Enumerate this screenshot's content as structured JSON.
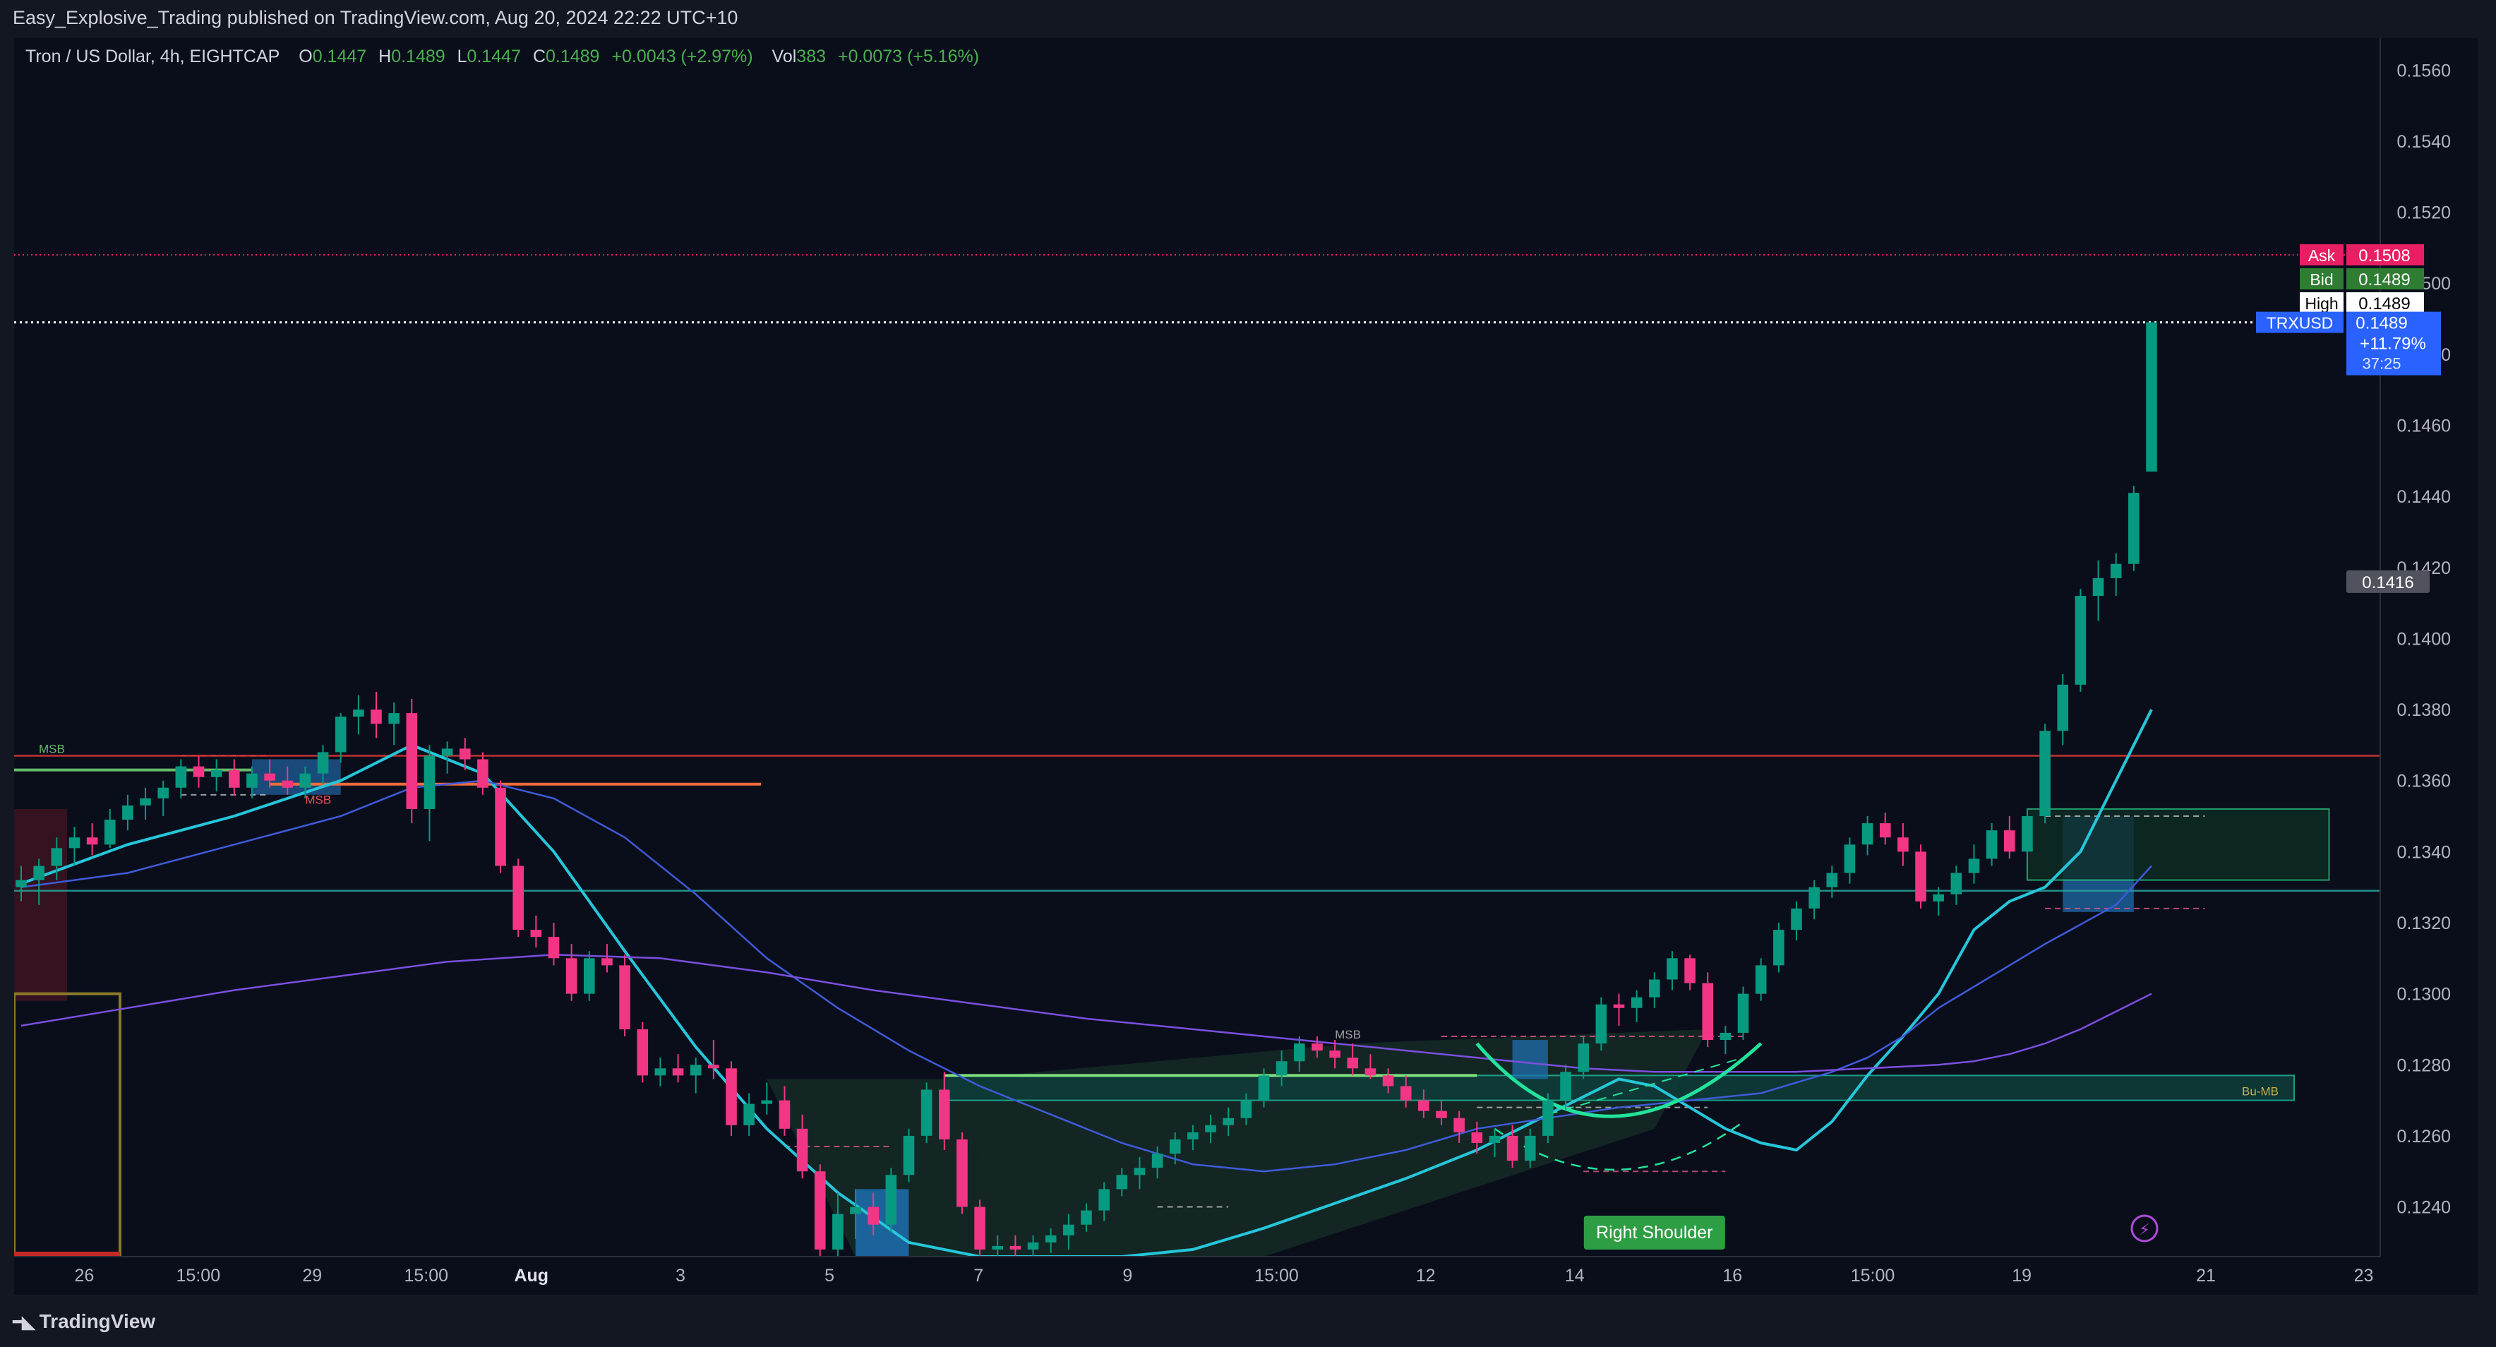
{
  "header": {
    "publisher_line": "Easy_Explosive_Trading published on TradingView.com, Aug 20, 2024 22:22 UTC+10"
  },
  "legend": {
    "symbol": "Tron / US Dollar, 4h, EIGHTCAP",
    "open_label": "O",
    "open": "0.1447",
    "high_label": "H",
    "high": "0.1489",
    "low_label": "L",
    "low": "0.1447",
    "close_label": "C",
    "close": "0.1489",
    "change": "+0.0043 (+2.97%)",
    "vol_label": "Vol",
    "vol": "383",
    "vol_change": "+0.0073 (+5.16%)"
  },
  "footer": {
    "brand": "TradingView"
  },
  "colors": {
    "background": "#0a0e1b",
    "up": "#089981",
    "down": "#f23685",
    "ema_fast": "#26c6da",
    "ema_mid": "#3f5bd9",
    "ema_slow": "#7b4fe0",
    "ask": "#e91e63",
    "bid": "#2e7d32",
    "last": "#2962ff",
    "resistance": "#e53935",
    "support": "#26a69a",
    "pattern": "#22e39a"
  },
  "chart_data": {
    "type": "candlestick",
    "symbol": "TRXUSD",
    "timeframe": "4h",
    "exchange": "EIGHTCAP",
    "y_axis": {
      "ticks": [
        "0.1240",
        "0.1260",
        "0.1280",
        "0.1300",
        "0.1320",
        "0.1340",
        "0.1360",
        "0.1380",
        "0.1400",
        "0.1420",
        "0.1440",
        "0.1460",
        "0.1480",
        "0.1500",
        "0.1520",
        "0.1540",
        "0.1560"
      ],
      "range": [
        0.1226,
        0.1569
      ]
    },
    "x_axis": {
      "ticks": [
        "26",
        "15:00",
        "29",
        "15:00",
        "Aug",
        "3",
        "5",
        "7",
        "9",
        "15:00",
        "12",
        "14",
        "16",
        "15:00",
        "19",
        "21",
        "23"
      ],
      "bold_ticks": [
        "Aug"
      ]
    },
    "price_labels": [
      {
        "name": "Ask",
        "value": "0.1508",
        "color": "#e91e63"
      },
      {
        "name": "Bid",
        "value": "0.1489",
        "color": "#2e7d32"
      },
      {
        "name": "High",
        "value": "0.1489",
        "color": "#ffffff"
      }
    ],
    "last_price": {
      "symbol": "TRXUSD",
      "value": "0.1489",
      "change": "+11.79%",
      "countdown": "37:25"
    },
    "crosshair_label": "0.1416",
    "annotations": {
      "msb_left": "MSB",
      "msb_mid": "MSB",
      "msb_mid2": "MSB",
      "bu_mb": "Bu-MB",
      "right_shoulder": "Right Shoulder"
    },
    "ohlc": [
      [
        0.133,
        0.1336,
        0.1326,
        0.1332
      ],
      [
        0.1332,
        0.1338,
        0.1325,
        0.1336
      ],
      [
        0.1336,
        0.1344,
        0.1332,
        0.1341
      ],
      [
        0.1341,
        0.1347,
        0.1336,
        0.1344
      ],
      [
        0.1344,
        0.1348,
        0.1339,
        0.1342
      ],
      [
        0.1342,
        0.1352,
        0.1341,
        0.1349
      ],
      [
        0.1349,
        0.1356,
        0.1346,
        0.1353
      ],
      [
        0.1353,
        0.1358,
        0.1349,
        0.1355
      ],
      [
        0.1355,
        0.136,
        0.135,
        0.1358
      ],
      [
        0.1358,
        0.1366,
        0.1355,
        0.1364
      ],
      [
        0.1364,
        0.1367,
        0.1358,
        0.1361
      ],
      [
        0.1361,
        0.1366,
        0.1357,
        0.1363
      ],
      [
        0.1363,
        0.1366,
        0.1356,
        0.1358
      ],
      [
        0.1358,
        0.1364,
        0.1355,
        0.1362
      ],
      [
        0.1362,
        0.1366,
        0.1358,
        0.136
      ],
      [
        0.136,
        0.1364,
        0.1356,
        0.1358
      ],
      [
        0.1358,
        0.1364,
        0.1355,
        0.1362
      ],
      [
        0.1362,
        0.137,
        0.1359,
        0.1368
      ],
      [
        0.1368,
        0.1379,
        0.1365,
        0.1378
      ],
      [
        0.1378,
        0.1384,
        0.1373,
        0.138
      ],
      [
        0.138,
        0.1385,
        0.1372,
        0.1376
      ],
      [
        0.1376,
        0.1382,
        0.137,
        0.1379
      ],
      [
        0.1379,
        0.1383,
        0.1348,
        0.1352
      ],
      [
        0.1352,
        0.137,
        0.1343,
        0.1367
      ],
      [
        0.1367,
        0.1371,
        0.1362,
        0.1369
      ],
      [
        0.1369,
        0.1372,
        0.1363,
        0.1366
      ],
      [
        0.1366,
        0.1368,
        0.1356,
        0.1358
      ],
      [
        0.1358,
        0.136,
        0.1334,
        0.1336
      ],
      [
        0.1336,
        0.1338,
        0.1316,
        0.1318
      ],
      [
        0.1318,
        0.1322,
        0.1313,
        0.1316
      ],
      [
        0.1316,
        0.132,
        0.1308,
        0.131
      ],
      [
        0.131,
        0.1314,
        0.1298,
        0.13
      ],
      [
        0.13,
        0.1312,
        0.1298,
        0.131
      ],
      [
        0.131,
        0.1314,
        0.1306,
        0.1308
      ],
      [
        0.1308,
        0.1311,
        0.1288,
        0.129
      ],
      [
        0.129,
        0.1292,
        0.1275,
        0.1277
      ],
      [
        0.1277,
        0.1282,
        0.1274,
        0.1279
      ],
      [
        0.1279,
        0.1283,
        0.1275,
        0.1277
      ],
      [
        0.1277,
        0.1282,
        0.1272,
        0.128
      ],
      [
        0.128,
        0.1287,
        0.1276,
        0.1279
      ],
      [
        0.1279,
        0.1281,
        0.126,
        0.1263
      ],
      [
        0.1263,
        0.1272,
        0.126,
        0.1269
      ],
      [
        0.1269,
        0.1275,
        0.1266,
        0.127
      ],
      [
        0.127,
        0.1274,
        0.126,
        0.1262
      ],
      [
        0.1262,
        0.1266,
        0.1248,
        0.125
      ],
      [
        0.125,
        0.1252,
        0.1226,
        0.1228
      ],
      [
        0.1228,
        0.1244,
        0.1226,
        0.1238
      ],
      [
        0.1238,
        0.1245,
        0.1231,
        0.124
      ],
      [
        0.124,
        0.1244,
        0.1232,
        0.1235
      ],
      [
        0.1235,
        0.1251,
        0.1233,
        0.1249
      ],
      [
        0.1249,
        0.1262,
        0.1247,
        0.126
      ],
      [
        0.126,
        0.1275,
        0.1258,
        0.1273
      ],
      [
        0.1273,
        0.1278,
        0.1256,
        0.1259
      ],
      [
        0.1259,
        0.1261,
        0.1238,
        0.124
      ],
      [
        0.124,
        0.1242,
        0.1226,
        0.1228
      ],
      [
        0.1228,
        0.1232,
        0.1226,
        0.1229
      ],
      [
        0.1229,
        0.1232,
        0.1226,
        0.1228
      ],
      [
        0.1228,
        0.1232,
        0.1226,
        0.123
      ],
      [
        0.123,
        0.1234,
        0.1227,
        0.1232
      ],
      [
        0.1232,
        0.1238,
        0.1228,
        0.1235
      ],
      [
        0.1235,
        0.1241,
        0.1233,
        0.1239
      ],
      [
        0.1239,
        0.1247,
        0.1236,
        0.1245
      ],
      [
        0.1245,
        0.1251,
        0.1243,
        0.1249
      ],
      [
        0.1249,
        0.1254,
        0.1245,
        0.1251
      ],
      [
        0.1251,
        0.1257,
        0.1248,
        0.1255
      ],
      [
        0.1255,
        0.1261,
        0.1252,
        0.1259
      ],
      [
        0.1259,
        0.1263,
        0.1256,
        0.1261
      ],
      [
        0.1261,
        0.1266,
        0.1258,
        0.1263
      ],
      [
        0.1263,
        0.1268,
        0.126,
        0.1265
      ],
      [
        0.1265,
        0.1272,
        0.1263,
        0.127
      ],
      [
        0.127,
        0.1279,
        0.1268,
        0.1277
      ],
      [
        0.1277,
        0.1284,
        0.1274,
        0.1281
      ],
      [
        0.1281,
        0.1288,
        0.1278,
        0.1286
      ],
      [
        0.1286,
        0.1288,
        0.1282,
        0.1284
      ],
      [
        0.1284,
        0.1287,
        0.1279,
        0.1282
      ],
      [
        0.1282,
        0.1286,
        0.1277,
        0.1279
      ],
      [
        0.1279,
        0.1283,
        0.1276,
        0.1277
      ],
      [
        0.1277,
        0.1279,
        0.1272,
        0.1274
      ],
      [
        0.1274,
        0.1277,
        0.1268,
        0.127
      ],
      [
        0.127,
        0.1273,
        0.1265,
        0.1267
      ],
      [
        0.1267,
        0.127,
        0.1263,
        0.1265
      ],
      [
        0.1265,
        0.1267,
        0.1258,
        0.1261
      ],
      [
        0.1261,
        0.1264,
        0.1255,
        0.1258
      ],
      [
        0.1258,
        0.1262,
        0.1254,
        0.126
      ],
      [
        0.126,
        0.1263,
        0.1251,
        0.1253
      ],
      [
        0.1253,
        0.1262,
        0.1251,
        0.126
      ],
      [
        0.126,
        0.1272,
        0.1258,
        0.127
      ],
      [
        0.127,
        0.128,
        0.1267,
        0.1278
      ],
      [
        0.1278,
        0.1288,
        0.1276,
        0.1286
      ],
      [
        0.1286,
        0.1299,
        0.1284,
        0.1297
      ],
      [
        0.1297,
        0.13,
        0.1291,
        0.1296
      ],
      [
        0.1296,
        0.1301,
        0.1292,
        0.1299
      ],
      [
        0.1299,
        0.1306,
        0.1296,
        0.1304
      ],
      [
        0.1304,
        0.1312,
        0.1301,
        0.131
      ],
      [
        0.131,
        0.1311,
        0.1301,
        0.1303
      ],
      [
        0.1303,
        0.1306,
        0.1285,
        0.1287
      ],
      [
        0.1287,
        0.1291,
        0.1283,
        0.1289
      ],
      [
        0.1289,
        0.1302,
        0.1287,
        0.13
      ],
      [
        0.13,
        0.131,
        0.1298,
        0.1308
      ],
      [
        0.1308,
        0.132,
        0.1306,
        0.1318
      ],
      [
        0.1318,
        0.1326,
        0.1315,
        0.1324
      ],
      [
        0.1324,
        0.1332,
        0.1321,
        0.133
      ],
      [
        0.133,
        0.1336,
        0.1327,
        0.1334
      ],
      [
        0.1334,
        0.1344,
        0.1331,
        0.1342
      ],
      [
        0.1342,
        0.135,
        0.1339,
        0.1348
      ],
      [
        0.1348,
        0.1351,
        0.1342,
        0.1344
      ],
      [
        0.1344,
        0.1348,
        0.1336,
        0.134
      ],
      [
        0.134,
        0.1342,
        0.1324,
        0.1326
      ],
      [
        0.1326,
        0.133,
        0.1322,
        0.1328
      ],
      [
        0.1328,
        0.1336,
        0.1325,
        0.1334
      ],
      [
        0.1334,
        0.1342,
        0.1331,
        0.1338
      ],
      [
        0.1338,
        0.1348,
        0.1336,
        0.1346
      ],
      [
        0.1346,
        0.135,
        0.1338,
        0.134
      ],
      [
        0.134,
        0.1352,
        0.1338,
        0.135
      ],
      [
        0.135,
        0.1376,
        0.1348,
        0.1374
      ],
      [
        0.1374,
        0.139,
        0.137,
        0.1387
      ],
      [
        0.1387,
        0.1414,
        0.1385,
        0.1412
      ],
      [
        0.1412,
        0.1422,
        0.1405,
        0.1417
      ],
      [
        0.1417,
        0.1424,
        0.1412,
        0.1421
      ],
      [
        0.1421,
        0.1443,
        0.1419,
        0.1441
      ],
      [
        0.1447,
        0.1489,
        0.1447,
        0.1489
      ]
    ],
    "moving_averages": [
      {
        "name": "EMA fast",
        "color": "#26c6da",
        "values": [
          0.1331,
          0.1342,
          0.135,
          0.136,
          0.137,
          0.1362,
          0.134,
          0.1312,
          0.1285,
          0.1262,
          0.1244,
          0.123,
          0.1226,
          0.1226,
          0.1226,
          0.1228,
          0.1234,
          0.1241,
          0.1248,
          0.1256,
          0.1266,
          0.1276,
          0.1274,
          0.1268,
          0.1262,
          0.1258,
          0.1256,
          0.1264,
          0.1277,
          0.1288,
          0.13,
          0.1318,
          0.1326,
          0.133,
          0.134,
          0.136,
          0.138
        ],
        "x_index": [
          0,
          6,
          12,
          18,
          22,
          26,
          30,
          34,
          38,
          42,
          46,
          50,
          54,
          58,
          62,
          66,
          70,
          74,
          78,
          82,
          86,
          90,
          92,
          94,
          96,
          98,
          100,
          102,
          104,
          106,
          108,
          110,
          112,
          114,
          116,
          118,
          120
        ]
      },
      {
        "name": "EMA mid",
        "color": "#3f5bd9",
        "values": [
          0.133,
          0.1334,
          0.1342,
          0.135,
          0.1358,
          0.136,
          0.1355,
          0.1344,
          0.1328,
          0.131,
          0.1296,
          0.1284,
          0.1274,
          0.1266,
          0.1258,
          0.1252,
          0.125,
          0.1252,
          0.1256,
          0.1262,
          0.1265,
          0.1268,
          0.127,
          0.1271,
          0.1272,
          0.1275,
          0.1278,
          0.1282,
          0.1288,
          0.1296,
          0.1302,
          0.1308,
          0.1314,
          0.1325,
          0.1336
        ],
        "x_index": [
          0,
          6,
          12,
          18,
          22,
          26,
          30,
          34,
          38,
          42,
          46,
          50,
          54,
          58,
          62,
          66,
          70,
          74,
          78,
          82,
          86,
          90,
          94,
          96,
          98,
          100,
          102,
          104,
          106,
          108,
          110,
          112,
          114,
          118,
          120
        ]
      },
      {
        "name": "EMA slow",
        "color": "#7b4fe0",
        "values": [
          0.1291,
          0.1296,
          0.1301,
          0.1305,
          0.1309,
          0.1311,
          0.131,
          0.1306,
          0.1301,
          0.1297,
          0.1293,
          0.129,
          0.1287,
          0.1284,
          0.1281,
          0.1279,
          0.1278,
          0.1278,
          0.1278,
          0.1279,
          0.128,
          0.1281,
          0.1283,
          0.1286,
          0.129,
          0.1295,
          0.13
        ],
        "x_index": [
          0,
          6,
          12,
          18,
          24,
          30,
          36,
          42,
          48,
          54,
          60,
          66,
          72,
          78,
          84,
          88,
          92,
          96,
          100,
          104,
          108,
          110,
          112,
          114,
          116,
          118,
          120
        ]
      }
    ]
  }
}
